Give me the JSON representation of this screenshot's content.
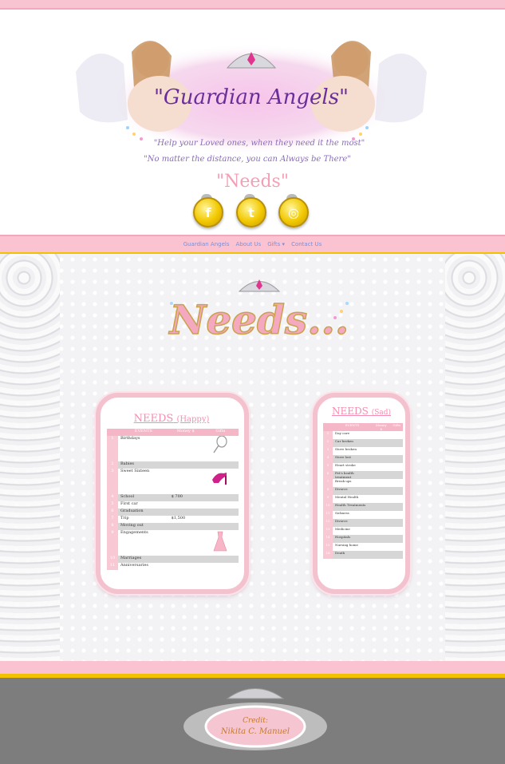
{
  "header": {
    "logo_title": "\"Guardian Angels\"",
    "tagline_1": "\"Help your Loved ones, when they need it the most\"",
    "tagline_2": "\"No matter the distance, you can Always be There\"",
    "page_heading": "\"Needs\""
  },
  "social": [
    {
      "name": "facebook",
      "glyph": "f"
    },
    {
      "name": "twitter",
      "glyph": "t"
    },
    {
      "name": "instagram",
      "glyph": "◎"
    }
  ],
  "nav": {
    "items": [
      "Guardian Angels",
      "About Us",
      "Gifts",
      "Contact Us"
    ],
    "caret": "▾"
  },
  "main": {
    "decorative_title": "Needs..."
  },
  "happy": {
    "title": "NEEDS",
    "subtitle": "(Happy)",
    "headers": [
      "",
      "EVENTS",
      "Money $",
      "Gifts"
    ],
    "rows": [
      {
        "n": "1",
        "event": "Birthdays",
        "money": "",
        "gift": "racket"
      },
      {
        "n": "2",
        "event": "Babies",
        "money": "",
        "gift": ""
      },
      {
        "n": "3",
        "event": "Sweet Sixteen",
        "money": "",
        "gift": "heel"
      },
      {
        "n": "4",
        "event": "School",
        "money": "$ 700",
        "gift": ""
      },
      {
        "n": "5",
        "event": "First car",
        "money": "",
        "gift": ""
      },
      {
        "n": "6",
        "event": "Graduation",
        "money": "",
        "gift": ""
      },
      {
        "n": "7",
        "event": "Trip",
        "money": "$1,500",
        "gift": ""
      },
      {
        "n": "8",
        "event": "Moving out",
        "money": "",
        "gift": ""
      },
      {
        "n": "9",
        "event": "Engagements",
        "money": "",
        "gift": "dress"
      },
      {
        "n": "10",
        "event": "Marriages",
        "money": "",
        "gift": ""
      },
      {
        "n": "11",
        "event": "Anniversaries",
        "money": "",
        "gift": ""
      }
    ]
  },
  "sad": {
    "title": "NEEDS",
    "subtitle": "(Sad)",
    "headers": [
      "",
      "EVENTS",
      "Money $",
      "Gifts"
    ],
    "rows": [
      {
        "n": "1",
        "event": "Day care"
      },
      {
        "n": "2",
        "event": "Car broken"
      },
      {
        "n": "3",
        "event": "Stove broken"
      },
      {
        "n": "4",
        "event": "Stove lost"
      },
      {
        "n": "5",
        "event": "Heart stroke"
      },
      {
        "n": "6",
        "event": "Pet's health treatment"
      },
      {
        "n": "7",
        "event": "Break ups"
      },
      {
        "n": "8",
        "event": "Divorce"
      },
      {
        "n": "9",
        "event": "Mental Health"
      },
      {
        "n": "10",
        "event": "Health Treatments"
      },
      {
        "n": "11",
        "event": "Sickness"
      },
      {
        "n": "12",
        "event": "Divorce"
      },
      {
        "n": "13",
        "event": "Medicine"
      },
      {
        "n": "14",
        "event": "Hospitals"
      },
      {
        "n": "15",
        "event": "Nursing home"
      },
      {
        "n": "16",
        "event": "Death"
      }
    ]
  },
  "footer": {
    "credit_line_1": "Credit:",
    "credit_line_2": "Nikita C. Manuel"
  },
  "colors": {
    "pink": "#f9c4d2",
    "gold": "#f2c200",
    "title_pink": "#f38fae",
    "nav_link": "#7b8fd6",
    "footer_grey": "#7d7d7d"
  }
}
